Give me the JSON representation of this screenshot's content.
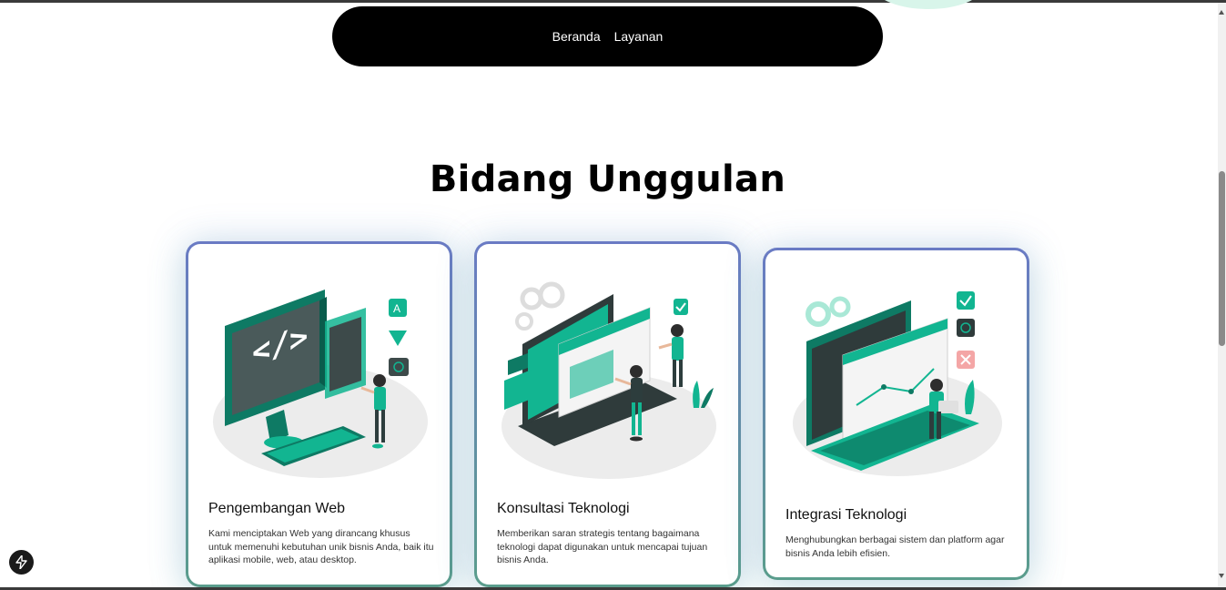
{
  "nav": {
    "links": [
      "Beranda",
      "Layanan"
    ]
  },
  "section": {
    "title": "Bidang Unggulan"
  },
  "cards": [
    {
      "title": "Pengembangan Web",
      "description": "Kami menciptakan Web yang dirancang khusus untuk memenuhi kebutuhan unik bisnis Anda, baik itu aplikasi mobile, web, atau desktop.",
      "illustration": "web-development-illustration"
    },
    {
      "title": "Konsultasi Teknologi",
      "description": "Memberikan saran strategis tentang bagaimana teknologi dapat digunakan untuk mencapai tujuan bisnis Anda.",
      "illustration": "tech-consulting-illustration"
    },
    {
      "title": "Integrasi Teknologi",
      "description": "Menghubungkan berbagai sistem dan platform agar bisnis Anda lebih efisien.",
      "illustration": "tech-integration-illustration"
    }
  ],
  "colors": {
    "accent": "#12b591",
    "accent_dark": "#0e8a6f",
    "navbar_bg": "#000000"
  },
  "icons": {
    "fab": "lightning-icon"
  }
}
